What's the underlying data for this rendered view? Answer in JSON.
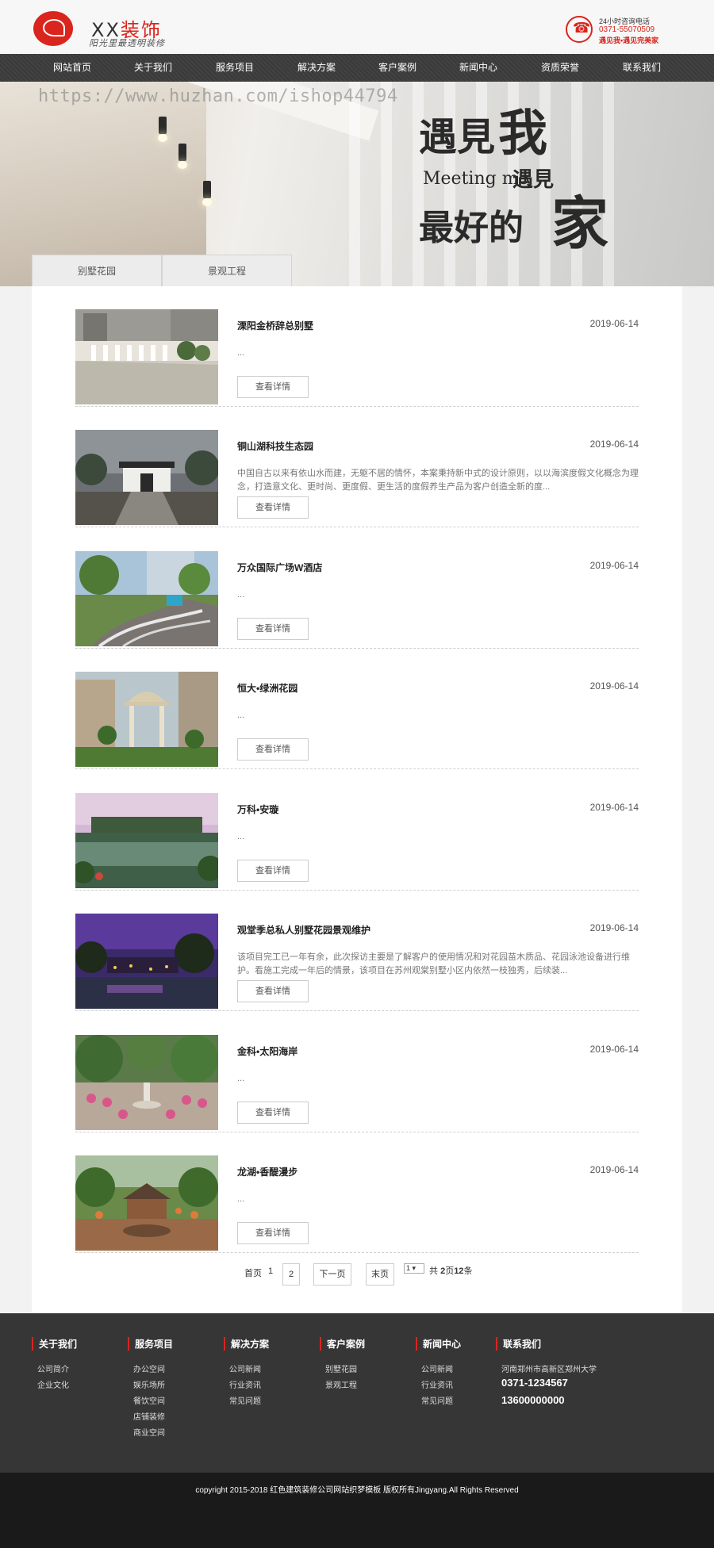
{
  "header": {
    "logo_xx": "XX",
    "logo_zs": "装饰",
    "slogan": "阳光里最透明装修",
    "hotline_label": "24小时咨询电话",
    "hotline_number": "0371-55070509",
    "hotline_slogan": "遇见我•遇见完美家"
  },
  "nav": [
    "网站首页",
    "关于我们",
    "服务项目",
    "解决方案",
    "客户案例",
    "新闻中心",
    "资质荣誉",
    "联系我们"
  ],
  "banner": {
    "watermark": "https://www.huzhan.com/ishop44794",
    "cn1": "遇見",
    "cn1b": "我",
    "en": "Meeting me",
    "cn2": "遇見",
    "cn3": "最好的",
    "cn3b": "家"
  },
  "tabs": [
    "别墅花园",
    "景观工程"
  ],
  "items": [
    {
      "title": "溧阳金桥辞总别墅",
      "date": "2019-06-14",
      "desc": "...",
      "button": "查看详情"
    },
    {
      "title": "铜山湖科技生态园",
      "date": "2019-06-14",
      "desc": "中国自古以来有依山水而建，无躯不居的情怀，本案秉持新中式的设计原则，以以海滨度假文化概念为理念，打造意文化、更时尚、更度假、更生活的度假养生产品为客户创造全新的度...",
      "button": "查看详情"
    },
    {
      "title": "万众国际广场W酒店",
      "date": "2019-06-14",
      "desc": "...",
      "button": "查看详情"
    },
    {
      "title": "恒大•绿洲花园",
      "date": "2019-06-14",
      "desc": "...",
      "button": "查看详情"
    },
    {
      "title": "万科•安璇",
      "date": "2019-06-14",
      "desc": "...",
      "button": "查看详情"
    },
    {
      "title": "观堂季总私人别墅花园景观维护",
      "date": "2019-06-14",
      "desc": "该项目完工已一年有余，此次探访主要是了解客户的使用情况和对花园苗木质品、花园泳池设备进行维护。看施工完成一年后的情景，该项目在苏州观棠别墅小区内依然一枝独秀，后续装...",
      "button": "查看详情"
    },
    {
      "title": "金科•太阳海岸",
      "date": "2019-06-14",
      "desc": "...",
      "button": "查看详情"
    },
    {
      "title": "龙湖•香醍漫步",
      "date": "2019-06-14",
      "desc": "...",
      "button": "查看详情"
    }
  ],
  "pager": {
    "first": "首页",
    "current": "1",
    "page2": "2",
    "next": "下一页",
    "last": "末页",
    "select_value": "1",
    "total_prefix": "共",
    "total_pages": "2",
    "total_mid": "页",
    "total_count": "12",
    "total_suffix": "条"
  },
  "footer": {
    "columns": [
      {
        "title": "关于我们",
        "links": [
          "公司简介",
          "企业文化"
        ]
      },
      {
        "title": "服务项目",
        "links": [
          "办公空间",
          "娱乐场所",
          "餐饮空间",
          "店铺装修",
          "商业空间"
        ]
      },
      {
        "title": "解决方案",
        "links": [
          "公司新闻",
          "行业资讯",
          "常见问题"
        ]
      },
      {
        "title": "客户案例",
        "links": [
          "别墅花园",
          "景观工程"
        ]
      },
      {
        "title": "新闻中心",
        "links": [
          "公司新闻",
          "行业资讯",
          "常见问题"
        ]
      }
    ],
    "contact_title": "联系我们",
    "address": "河南郑州市高新区郑州大学",
    "tel1": "0371-1234567",
    "tel2": "13600000000",
    "copyright": "copyright 2015-2018 红色建筑装修公司网站织梦模板 版权所有Jingyang.All Rights Reserved"
  },
  "colors": {
    "accent": "#d9251d",
    "nav_bg": "#3a3a3a",
    "footer_bg": "#363636",
    "copyright_bg": "#1a1a1a"
  }
}
